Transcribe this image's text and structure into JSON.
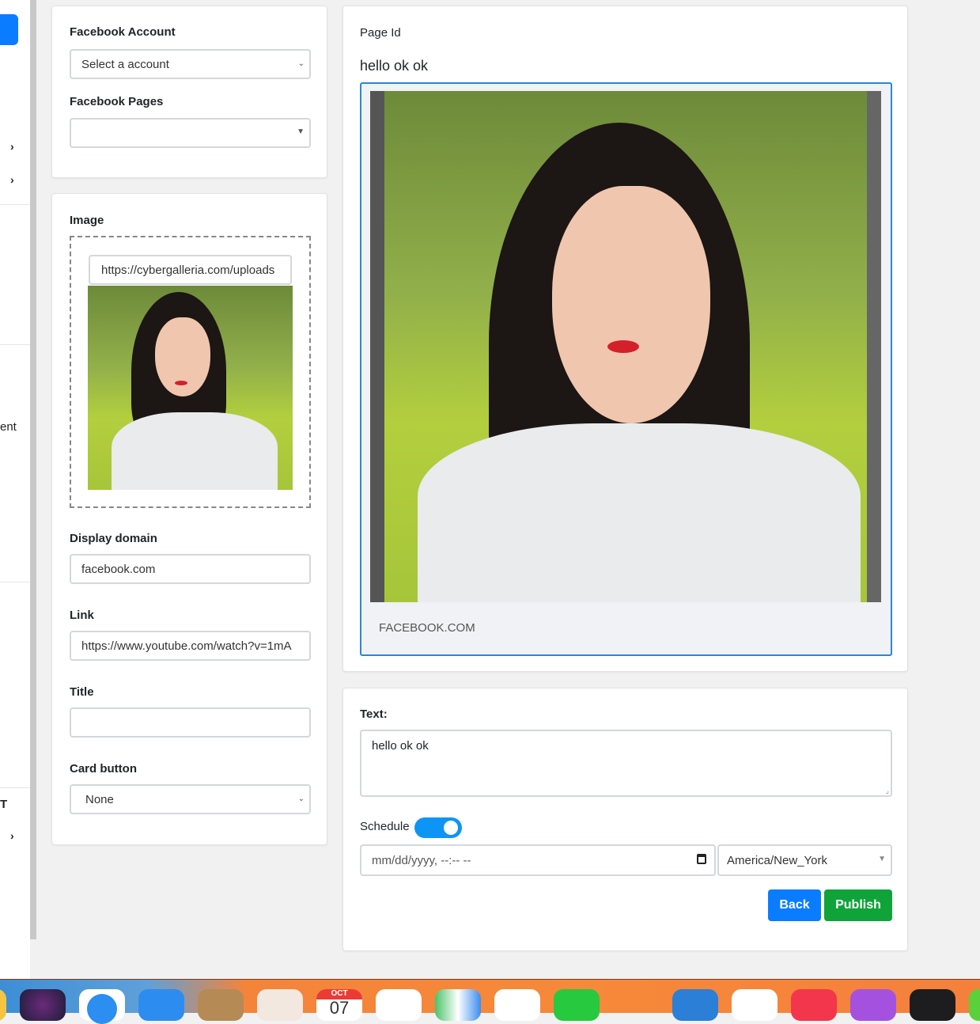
{
  "sidebar": {
    "partial_text_1": "ent",
    "partial_text_2": "T"
  },
  "account_card": {
    "account_label": "Facebook Account",
    "account_select": "Select a account",
    "pages_label": "Facebook Pages",
    "pages_select": ""
  },
  "form_card": {
    "image_label": "Image",
    "image_url": "https://cybergalleria.com/uploads",
    "display_domain_label": "Display domain",
    "display_domain_value": "facebook.com",
    "link_label": "Link",
    "link_value": "https://www.youtube.com/watch?v=1mA",
    "title_label": "Title",
    "title_value": "",
    "card_button_label": "Card button",
    "card_button_value": "None"
  },
  "preview": {
    "page_id_label": "Page Id",
    "message": "hello ok ok",
    "domain_caption": "FACEBOOK.COM"
  },
  "post": {
    "text_label": "Text:",
    "text_value": "hello ok ok",
    "schedule_label": "Schedule",
    "schedule_enabled": true,
    "datetime_placeholder": "mm/dd/yyyy, --:-- --",
    "timezone": "America/New_York",
    "back_label": "Back",
    "publish_label": "Publish"
  },
  "colors": {
    "primary": "#0a7cff",
    "success": "#0fa33a",
    "toggle": "#0d95f5"
  },
  "dock": {
    "calendar_month": "OCT",
    "calendar_day": "07",
    "apps": [
      "finder",
      "siri",
      "safari",
      "mail",
      "contacts",
      "launchpad",
      "calendar",
      "reminders",
      "maps",
      "photos",
      "facetime",
      "numbers",
      "keynote",
      "news",
      "music",
      "podcasts",
      "tv",
      "app"
    ]
  }
}
